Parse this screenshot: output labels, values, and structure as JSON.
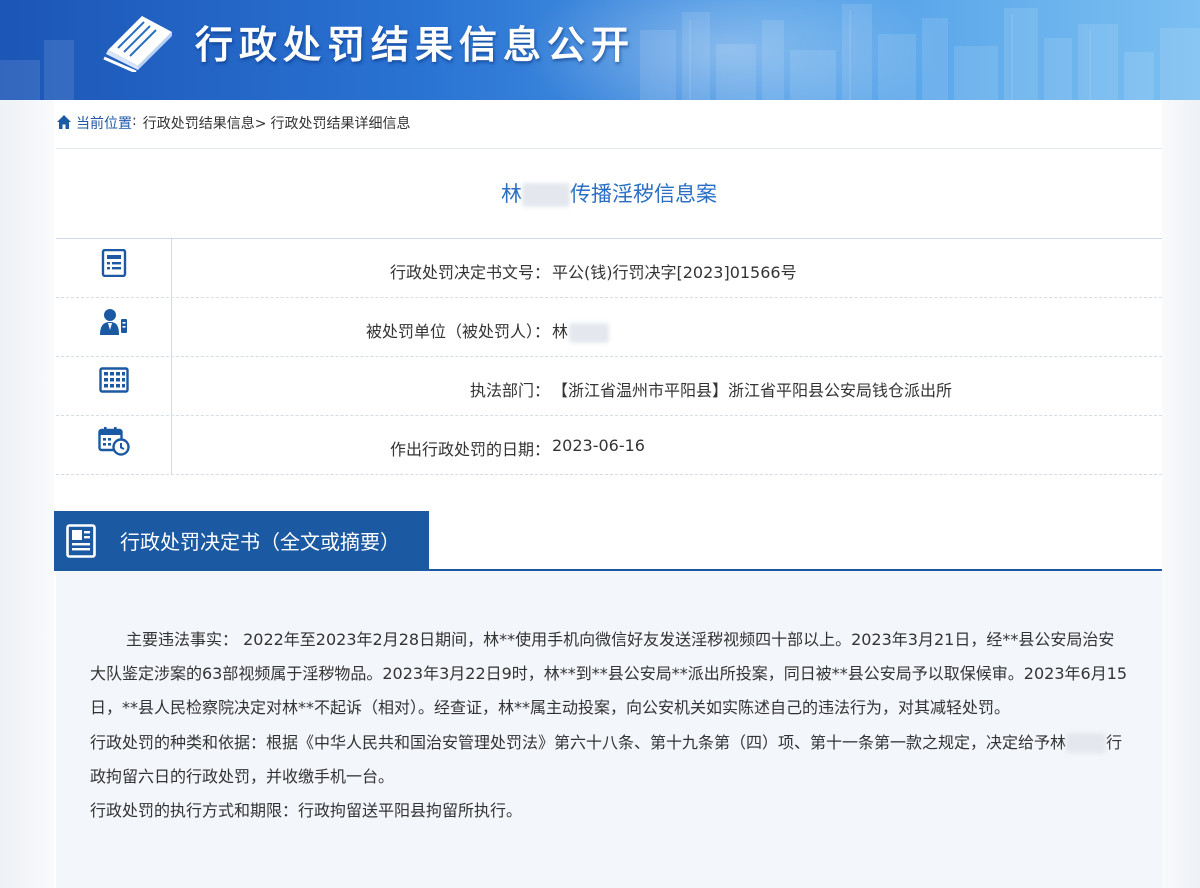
{
  "banner": {
    "title": "行政处罚结果信息公开",
    "icon": "book-icon",
    "colors": {
      "start": "#1c56b6",
      "end": "#7cc0f2"
    }
  },
  "breadcrumb": {
    "icon": "home-icon",
    "current_label": "当前位置",
    "separator": ":",
    "items": [
      "行政处罚结果信息>",
      "行政处罚结果详细信息"
    ]
  },
  "case": {
    "title_prefix": "林",
    "title_suffix": "传播淫秽信息案"
  },
  "info_rows": [
    {
      "icon": "document-list-icon",
      "label": "行政处罚决定书文号：",
      "value": "平公(钱)行罚决字[2023]01566号",
      "redacted": false
    },
    {
      "icon": "person-badge-icon",
      "label": "被处罚单位（被处罚人）：",
      "value": "林",
      "redacted": true
    },
    {
      "icon": "building-icon",
      "label": "执法部门：",
      "value": "【浙江省温州市平阳县】浙江省平阳县公安局钱仓派出所",
      "redacted": false
    },
    {
      "icon": "calendar-clock-icon",
      "label": "作出行政处罚的日期：",
      "value": "2023-06-16",
      "redacted": false
    }
  ],
  "section": {
    "icon": "document-icon",
    "label": "行政处罚决定书（全文或摘要）",
    "accent": "#1b5aa2"
  },
  "content": {
    "para1": "主要违法事实： 2022年至2023年2月28日期间，林**使用手机向微信好友发送淫秽视频四十部以上。2023年3月21日，经**县公安局治安大队鉴定涉案的63部视频属于淫秽物品。2023年3月22日9时，林**到**县公安局**派出所投案，同日被**县公安局予以取保候审。2023年6月15日，**县人民检察院决定对林**不起诉（相对）。经查证，林**属主动投案，向公安机关如实陈述自己的违法行为，对其减轻处罚。",
    "para2_start": "行政处罚的种类和依据：根据《中华人民共和国治安管理处罚法》第六十八条、第十九条第（四）项、第十一条第一款之规定，决定给予林",
    "para2_end": "行政拘留六日的行政处罚，并收缴手机一台。",
    "para3": "行政处罚的执行方式和期限：行政拘留送平阳县拘留所执行。"
  }
}
